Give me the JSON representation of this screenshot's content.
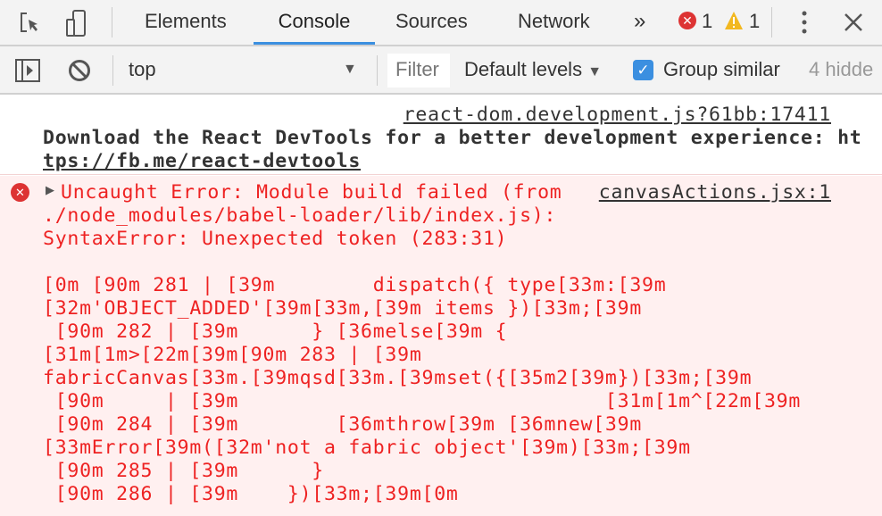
{
  "tabs": [
    {
      "label": "Elements"
    },
    {
      "label": "Console"
    },
    {
      "label": "Sources"
    },
    {
      "label": "Network"
    }
  ],
  "active_tab": "Console",
  "more_tabs": "»",
  "error_count": "1",
  "warning_count": "1",
  "context_select": {
    "value": "top"
  },
  "filter": {
    "placeholder": "Filter"
  },
  "levels": {
    "label": "Default levels"
  },
  "group_similar": {
    "label": "Group similar",
    "checked": true
  },
  "hidden": "4 hidde",
  "colors": {
    "accent": "#3b8fe0",
    "error": "#e22222",
    "error_bg": "#fff0f0"
  },
  "messages": [
    {
      "source": "react-dom.development.js?61bb:17411",
      "lines": [
        "Download the React DevTools for a better development experience: ht",
        "tps://fb.me/react-devtools"
      ]
    },
    {
      "type": "error",
      "source": "canvasActions.jsx:1",
      "lines": [
        "Uncaught Error: Module build failed (from",
        "./node_modules/babel-loader/lib/index.js):",
        "SyntaxError: Unexpected token (283:31)",
        "",
        "[0m [90m 281 | [39m        dispatch({ type[33m:[39m",
        "[32m'OBJECT_ADDED'[39m[33m,[39m items })[33m;[39m",
        " [90m 282 | [39m      } [36melse[39m {",
        "[31m[1m>[22m[39m[90m 283 | [39m",
        "fabricCanvas[33m.[39mqsd[33m.[39mset({[35m2[39m})[33m;[39m",
        " [90m     | [39m                              [31m[1m^[22m[39m",
        " [90m 284 | [39m        [36mthrow[39m [36mnew[39m",
        "[33mError[39m([32m'not a fabric object'[39m)[33m;[39m",
        " [90m 285 | [39m      }",
        " [90m 286 | [39m    })[33m;[39m[0m"
      ]
    }
  ]
}
